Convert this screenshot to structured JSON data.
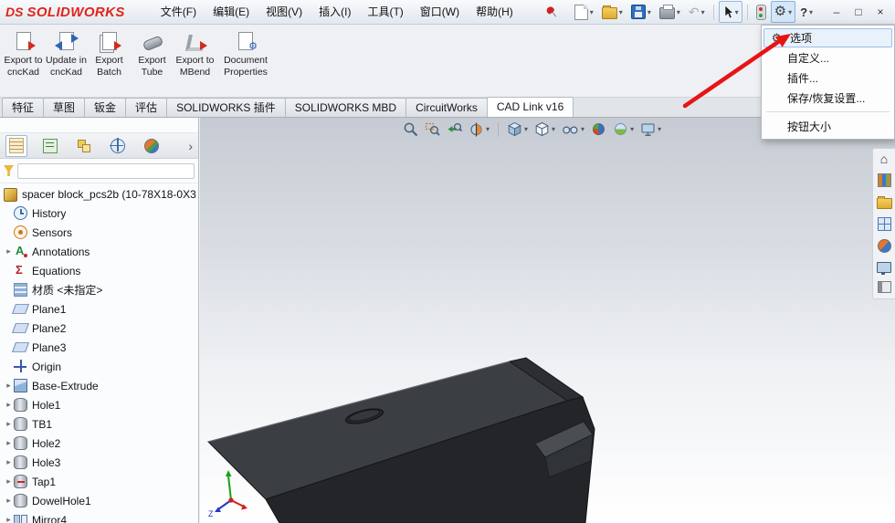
{
  "titlebar": {
    "brand": {
      "ds": "DS",
      "name": "SOLIDWORKS"
    },
    "menus": [
      "文件(F)",
      "编辑(E)",
      "视图(V)",
      "插入(I)",
      "工具(T)",
      "窗口(W)",
      "帮助(H)"
    ],
    "help_glyph": "?",
    "window_controls": {
      "minimize": "–",
      "maximize": "□",
      "close": "×"
    }
  },
  "ribbon": {
    "buttons": [
      {
        "label": "Export to cncKad"
      },
      {
        "label": "Update in cncKad"
      },
      {
        "label": "Export Batch"
      },
      {
        "label": "Export Tube"
      },
      {
        "label": "Export to MBend"
      },
      {
        "label": "Document Properties"
      }
    ]
  },
  "tabs": {
    "items": [
      {
        "label": "特征"
      },
      {
        "label": "草图"
      },
      {
        "label": "钣金"
      },
      {
        "label": "评估"
      },
      {
        "label": "SOLIDWORKS 插件"
      },
      {
        "label": "SOLIDWORKS MBD"
      },
      {
        "label": "CircuitWorks"
      },
      {
        "label": "CAD Link v16",
        "active": true
      }
    ]
  },
  "feature_tree": {
    "root": {
      "label": "spacer block_pcs2b (10-78X18-0X3"
    },
    "items": [
      {
        "label": "History"
      },
      {
        "label": "Sensors"
      },
      {
        "label": "Annotations"
      },
      {
        "label": "Equations"
      },
      {
        "label": "材质 <未指定>"
      },
      {
        "label": "Plane1"
      },
      {
        "label": "Plane2"
      },
      {
        "label": "Plane3"
      },
      {
        "label": "Origin"
      },
      {
        "label": "Base-Extrude"
      },
      {
        "label": "Hole1"
      },
      {
        "label": "TB1"
      },
      {
        "label": "Hole2"
      },
      {
        "label": "Hole3"
      },
      {
        "label": "Tap1"
      },
      {
        "label": "DowelHole1"
      },
      {
        "label": "Mirror4"
      }
    ]
  },
  "gear_menu": {
    "items": [
      {
        "label": "选项",
        "highlighted": true
      },
      {
        "label": "自定义..."
      },
      {
        "label": "插件..."
      },
      {
        "label": "保存/恢复设置..."
      },
      {
        "label": "按钮大小"
      }
    ]
  },
  "triad": {
    "z_label": "Z"
  },
  "colors": {
    "brand_red": "#e2231a",
    "arrow_red": "#e81414",
    "part_dark": "#2a2c2f"
  }
}
